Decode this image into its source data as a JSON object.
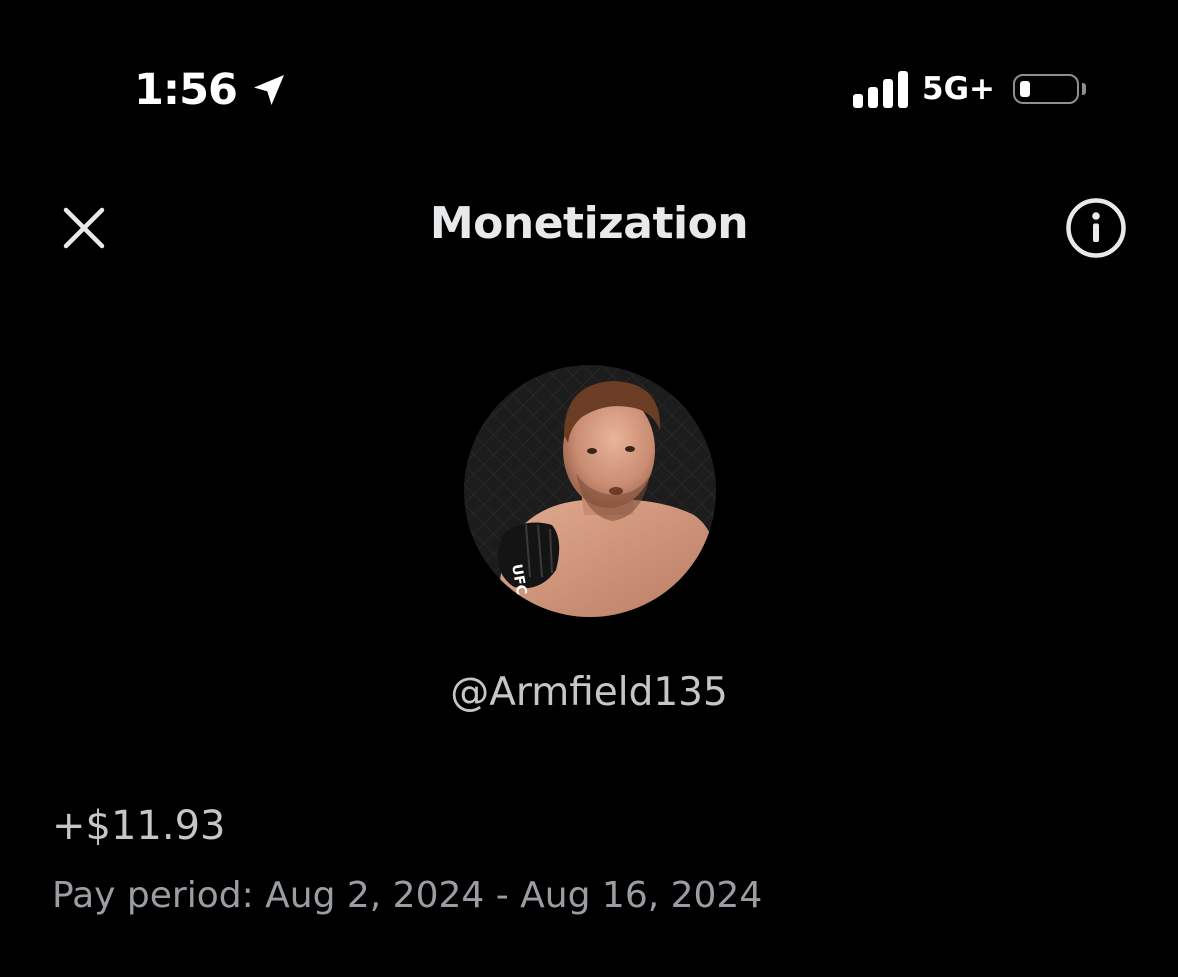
{
  "status_bar": {
    "time": "1:56",
    "location_icon": "location-arrow-icon",
    "signal_bars": 4,
    "network": "5G+",
    "battery_level": 0.2
  },
  "header": {
    "title": "Monetization",
    "close_icon": "close-icon",
    "info_icon": "info-icon"
  },
  "profile": {
    "avatar": "avatar",
    "handle": "@Armfield135"
  },
  "earnings": {
    "amount": "+$11.93",
    "pay_period": "Pay period: Aug 2, 2024 - Aug 16, 2024"
  },
  "colors": {
    "background": "#000000",
    "title_text": "#e7e9ea",
    "secondary_text": "#9a9ea2"
  }
}
